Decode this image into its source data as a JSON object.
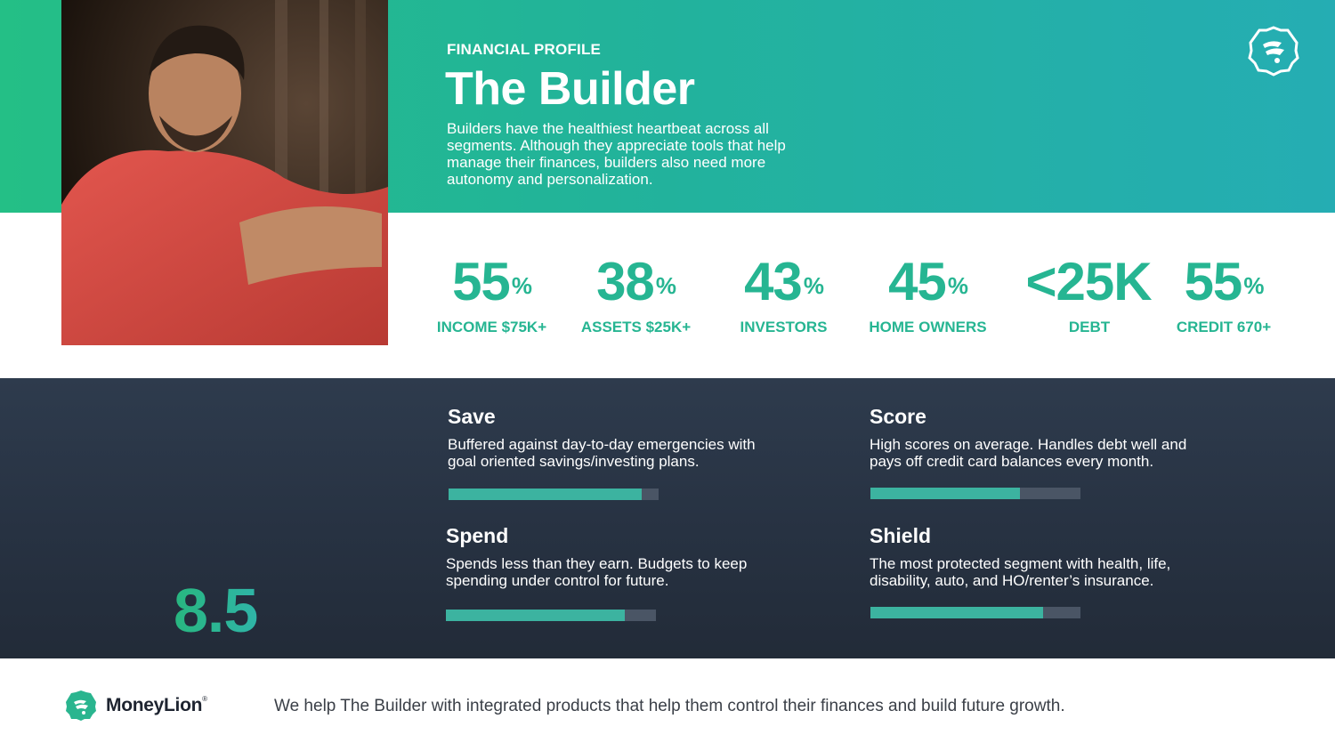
{
  "header": {
    "eyebrow": "FINANCIAL PROFILE",
    "title": "The Builder",
    "intro": "Builders have the healthiest heartbeat across all segments. Although they appreciate tools that help manage their finances, builders also need more autonomy and personalization."
  },
  "stats": [
    {
      "value": "55",
      "unit": "%",
      "label": "INCOME $75K+"
    },
    {
      "value": "38",
      "unit": "%",
      "label": "ASSETS $25K+"
    },
    {
      "value": "43",
      "unit": "%",
      "label": "INVESTORS"
    },
    {
      "value": "45",
      "unit": "%",
      "label": "HOME OWNERS"
    },
    {
      "value": "<25K",
      "unit": "",
      "label": "DEBT"
    },
    {
      "value": "55",
      "unit": "%",
      "label": "CREDIT 670+"
    }
  ],
  "score": {
    "value": "8.5"
  },
  "metrics": [
    {
      "title": "Save",
      "description": "Buffered against day-to-day emergencies with goal oriented savings/investing plans.",
      "level": 0.92
    },
    {
      "title": "Score",
      "description": "High scores on average. Handles debt well and pays off credit card balances every month.",
      "level": 0.71
    },
    {
      "title": "Spend",
      "description": "Spends less than they earn. Budgets to keep spending under control for future.",
      "level": 0.85
    },
    {
      "title": "Shield",
      "description": "The most protected segment with health, life, disability, auto, and HO/renter’s insurance.",
      "level": 0.82
    }
  ],
  "footer": {
    "brand": "MoneyLion",
    "brand_mark": "®",
    "tagline": "We help The Builder with integrated products that help them control their finances and build future growth."
  },
  "colors": {
    "accent_green": "#26b592",
    "dark_panel": "#273242",
    "bar_fill": "#3cb3a0"
  },
  "icons": {
    "brand_logo": "moneylion-lion-icon",
    "heartbeat": "heartbeat-bars-icon"
  }
}
